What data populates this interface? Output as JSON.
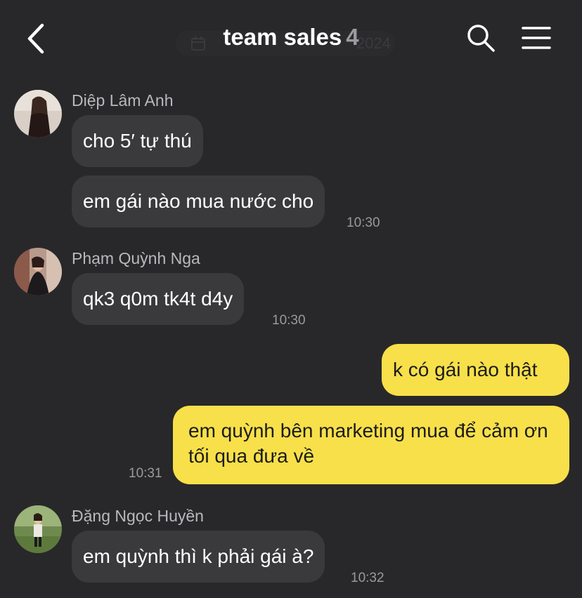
{
  "header": {
    "title": "team sales",
    "member_count": "4",
    "date_chip_text": "2024"
  },
  "messages": [
    {
      "sender": "Diệp Lâm Anh",
      "bubbles": [
        "cho 5′ tự thú",
        "em gái nào mua nước cho"
      ],
      "time": "10:30"
    },
    {
      "sender": "Phạm Quỳnh Nga",
      "bubbles": [
        "qk3 q0m tk4t d4y"
      ],
      "time": "10:30"
    },
    {
      "sender": "me",
      "bubbles": [
        "k có gái nào thật",
        "em quỳnh bên marketing mua để cảm ơn tối qua đưa về"
      ],
      "time": "10:31"
    },
    {
      "sender": "Đặng Ngọc Huyền",
      "bubbles": [
        "em quỳnh thì k phải gái à?"
      ],
      "time": "10:32"
    }
  ],
  "colors": {
    "background": "#28282a",
    "incoming_bubble": "#3a3a3d",
    "outgoing_bubble": "#f8e04a"
  },
  "icons": {
    "back": "chevron-left-icon",
    "search": "search-icon",
    "menu": "hamburger-menu-icon",
    "calendar": "calendar-icon"
  }
}
